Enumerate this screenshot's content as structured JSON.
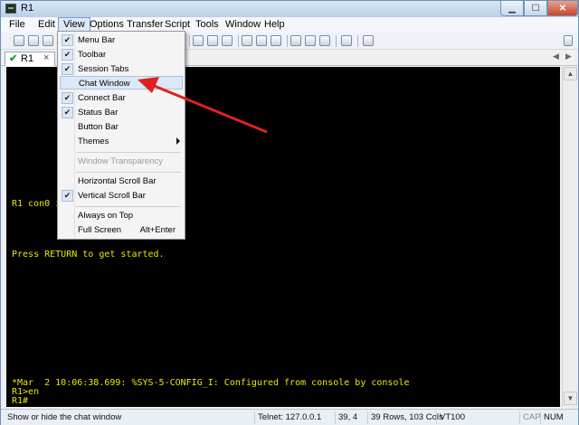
{
  "window": {
    "title": "R1"
  },
  "menubar": {
    "items": [
      {
        "label": "File"
      },
      {
        "label": "Edit"
      },
      {
        "label": "View"
      },
      {
        "label": "Options"
      },
      {
        "label": "Transfer"
      },
      {
        "label": "Script"
      },
      {
        "label": "Tools"
      },
      {
        "label": "Window"
      },
      {
        "label": "Help"
      }
    ],
    "open_menu": "View"
  },
  "toolbar": {
    "icons": [
      "connect-icon",
      "quick-connect-icon",
      "connect-in-tab-icon",
      "reconnect-icon",
      "disconnect-icon",
      "copy-icon",
      "paste-icon",
      "find-icon",
      "print-icon",
      "print-setup-icon",
      "log-session-icon",
      "session-options-icon",
      "keymap-icon",
      "sftp-icon",
      "help-icon",
      "about-icon"
    ]
  },
  "tabs": [
    {
      "label": "R1",
      "status": "connected",
      "close": "×"
    }
  ],
  "view_menu": {
    "items": [
      {
        "label": "Menu Bar",
        "checked": true
      },
      {
        "label": "Toolbar",
        "checked": true
      },
      {
        "label": "Session Tabs",
        "checked": true
      },
      {
        "label": "Chat Window",
        "checked": false,
        "highlighted": true
      },
      {
        "label": "Connect Bar",
        "checked": true
      },
      {
        "label": "Status Bar",
        "checked": true
      },
      {
        "label": "Button Bar",
        "checked": false
      },
      {
        "label": "Themes",
        "checked": false,
        "submenu": true
      },
      {
        "label": "Window Transparency",
        "checked": false,
        "disabled": true
      },
      {
        "label": "Horizontal Scroll Bar",
        "checked": false
      },
      {
        "label": "Vertical Scroll Bar",
        "checked": true
      },
      {
        "label": "Always on Top",
        "checked": false
      },
      {
        "label": "Full Screen",
        "checked": false,
        "shortcut": "Alt+Enter"
      }
    ]
  },
  "terminal": {
    "lines": [
      "R1 con0 is now available",
      "Press RETURN to get started.",
      "*Mar  2 10:06:38.699: %SYS-5-CONFIG_I: Configured from console by console",
      "R1>en",
      "R1#"
    ],
    "text_color": "#e8e800",
    "background": "#000000"
  },
  "statusbar": {
    "help_text": "Show or hide the chat window",
    "connection": "Telnet: 127.0.0.1",
    "cursor": "39,  4",
    "size": "39 Rows, 103 Cols",
    "emulation": "VT100",
    "caps": "CAP",
    "num": "NUM"
  },
  "colors": {
    "annotation_arrow": "#e02020",
    "menu_highlight": "#dbe8f7"
  }
}
